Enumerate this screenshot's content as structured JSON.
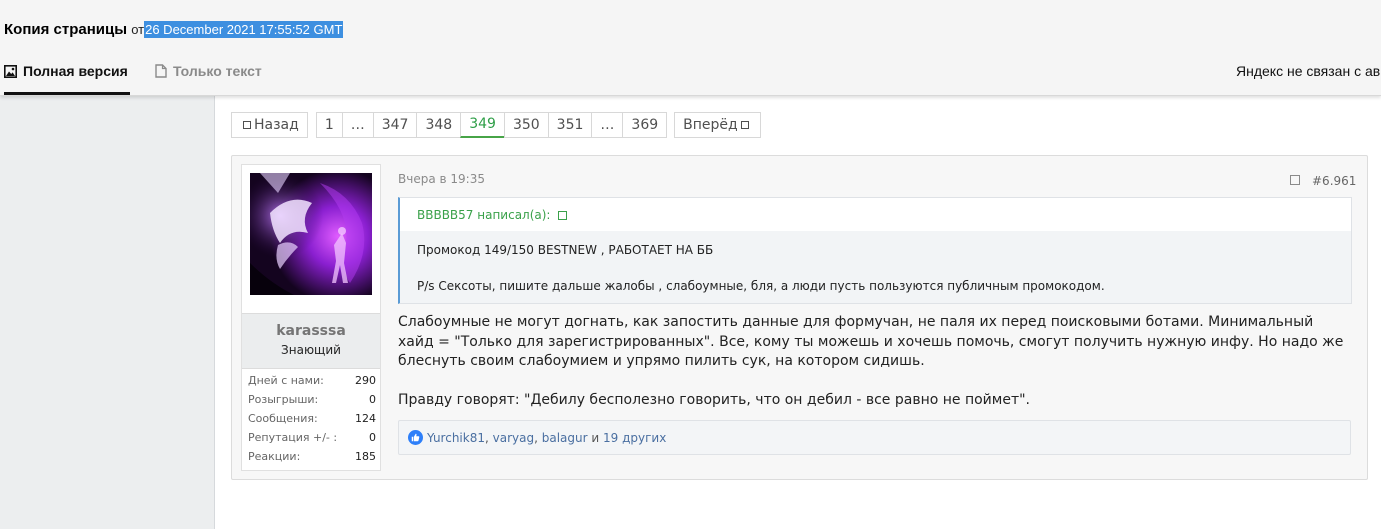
{
  "cache_header": {
    "title": "Копия страницы",
    "from": "от",
    "date": "26 December 2021 17:55:52 GMT",
    "tabs": [
      {
        "label": "Полная версия",
        "icon": "image-icon",
        "active": true
      },
      {
        "label": "Только текст",
        "icon": "document-icon",
        "active": false
      }
    ],
    "note": "Яндекс не связан с ав"
  },
  "pagination": {
    "prev_label": "Назад",
    "next_label": "Вперёд",
    "pages": [
      "1",
      "…",
      "347",
      "348",
      "349",
      "350",
      "351",
      "…",
      "369"
    ],
    "current": "349"
  },
  "post": {
    "username": "karasssa",
    "user_title": "Знающий",
    "stats": [
      {
        "label": "Дней с нами:",
        "value": "290"
      },
      {
        "label": "Розыгрыши:",
        "value": "0"
      },
      {
        "label": "Сообщения:",
        "value": "124"
      },
      {
        "label": "Репутация +/- :",
        "value": "0"
      },
      {
        "label": "Реакции:",
        "value": "185"
      }
    ],
    "date": "Вчера в 19:35",
    "number": "#6.961",
    "quote": {
      "author": "BBBBB57 написал(а):",
      "line1": "Промокод 149/150 BESTNEW , РАБОТАЕТ НА ББ",
      "line2": "P/s Сексоты, пишите дальше жалобы , слабоумные, бля, а люди пусть пользуются публичным промокодом."
    },
    "body": {
      "paragraph1": "Слабоумные не могут догнать, как запостить данные для формучан, не паля их перед поисковыми ботами. Минимальный хайд = \"Только для зарегистрированных\". Все, кому ты можешь и хочешь помочь, смогут получить нужную инфу. Но надо же блеснуть своим слабоумием и упрямо пилить сук, на котором сидишь.",
      "paragraph2": "Правду говорят: \"Дебилу бесполезно говорить, что он дебил - все равно не поймет\"."
    },
    "reactions": {
      "users": [
        "Yurchik81",
        "varyag",
        "balagur"
      ],
      "separator": ", ",
      "and_word": " и ",
      "others": "19 других"
    }
  },
  "colors": {
    "selection_highlight": "#3d8fe0",
    "current_page": "#2e9e47",
    "quote_author": "#3aa14a",
    "quote_border": "#5b9bd5",
    "reaction_link": "#4a6fa1",
    "like_icon": "#2d7ff9"
  }
}
